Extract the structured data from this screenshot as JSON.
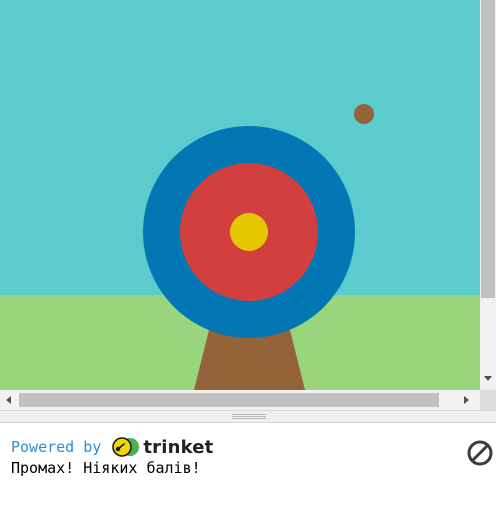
{
  "console": {
    "powered_by": "Powered by",
    "brand": "trinket",
    "output_line": "Промах! Ніяких балів!"
  },
  "icons": {
    "stop": "stop-icon",
    "logo": "trinket-logo-icon"
  },
  "colors": {
    "sky": "#5ccbcd",
    "grass": "#98d57c",
    "stand": "#94633a",
    "outer_ring": "#0277b4",
    "middle_ring": "#d23f3f",
    "bullseye": "#e6c800",
    "arrow": "#94633a",
    "powered_text": "#2a8fd6"
  }
}
